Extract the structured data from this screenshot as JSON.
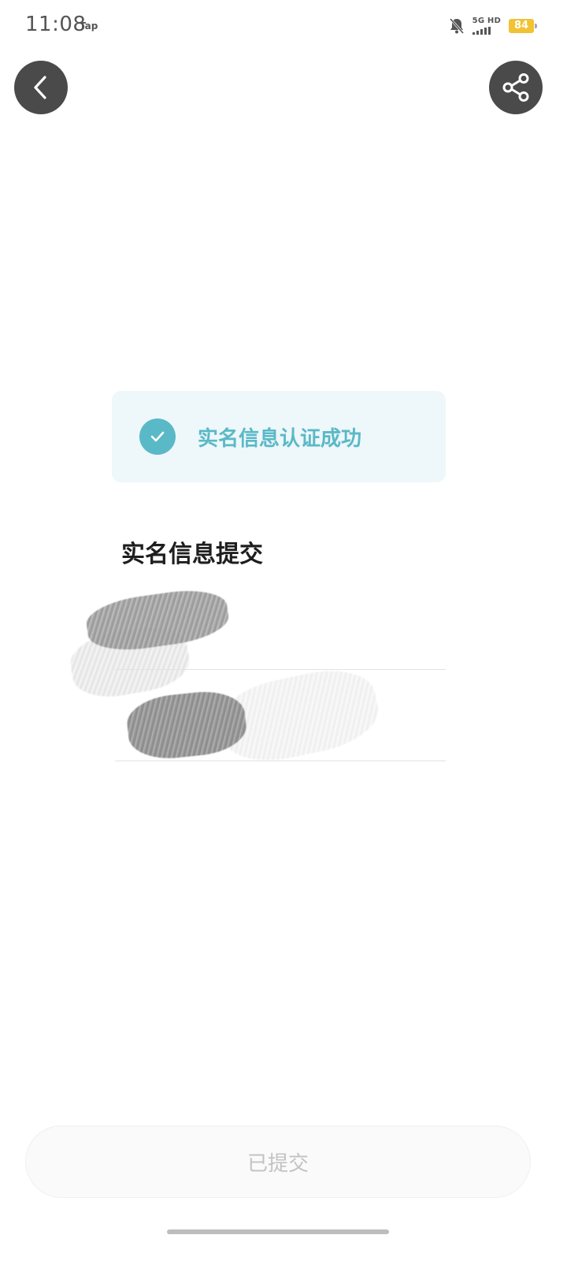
{
  "status_bar": {
    "time": "11:08",
    "app_tag": "Tap",
    "network": "5G HD",
    "battery": "84",
    "icons": [
      "mute-bell-icon",
      "signal-icon",
      "battery-icon"
    ]
  },
  "nav": {
    "back_icon": "chevron-left-icon",
    "share_icon": "share-icon"
  },
  "success_banner": {
    "text": "实名信息认证成功",
    "icon": "check-icon",
    "accent_color": "#5ab9c6"
  },
  "form": {
    "title": "实名信息提交"
  },
  "submit_button": {
    "label": "已提交"
  }
}
